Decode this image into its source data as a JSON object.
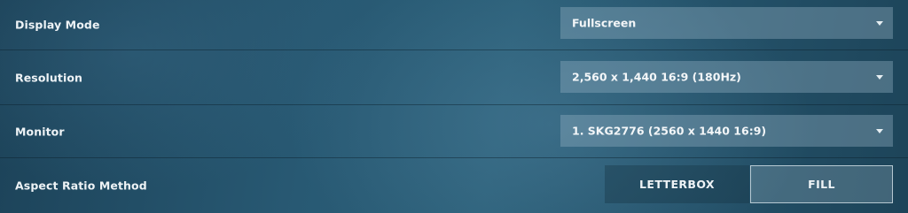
{
  "settings": {
    "display_mode": {
      "label": "Display Mode",
      "value": "Fullscreen"
    },
    "resolution": {
      "label": "Resolution",
      "value": "2,560 x 1,440 16:9 (180Hz)"
    },
    "monitor": {
      "label": "Monitor",
      "value": "1. SKG2776 (2560 x 1440 16:9)"
    },
    "aspect_ratio_method": {
      "label": "Aspect Ratio Method",
      "options": [
        "LETTERBOX",
        "FILL"
      ],
      "selected": "FILL"
    }
  }
}
